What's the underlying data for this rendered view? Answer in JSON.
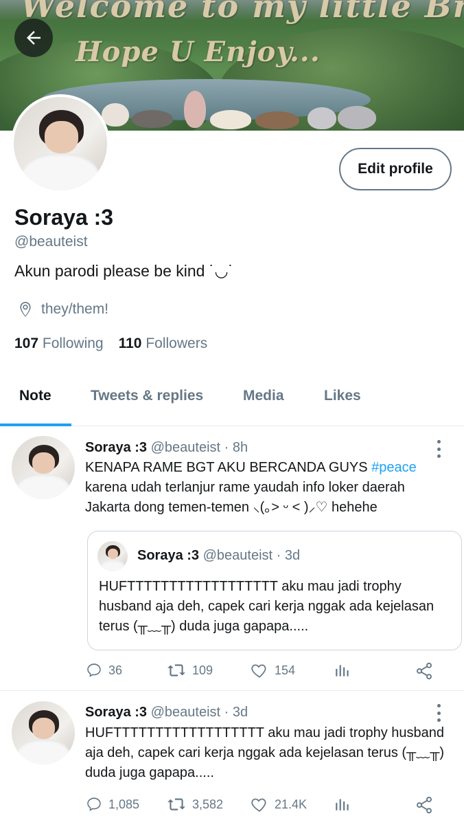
{
  "banner": {
    "line1": "Welcome to my little Brain...",
    "line2": "Hope U Enjoy..."
  },
  "nav": {
    "back_icon": "arrow-left-icon"
  },
  "profile": {
    "display_name": "Soraya :3",
    "handle": "@beauteist",
    "bio": "Akun parodi please be kind ˙◡˙",
    "location": "they/them!",
    "following_count": "107",
    "following_label": "Following",
    "followers_count": "110",
    "followers_label": "Followers",
    "edit_button": "Edit profile"
  },
  "tabs": [
    {
      "label": "Note",
      "active": true
    },
    {
      "label": "Tweets & replies",
      "active": false
    },
    {
      "label": "Media",
      "active": false
    },
    {
      "label": "Likes",
      "active": false
    }
  ],
  "tweets": [
    {
      "name": "Soraya :3",
      "handle": "@beauteist",
      "time": "· 8h",
      "text_main": "KENAPA RAME BGT AKU BERCANDA GUYS ",
      "hashtag": "#peace",
      "text_rest": "karena udah terlanjur rame yaudah info loker daerah Jakarta dong temen-temen ⸜(｡˃ ᵕ ˂ )⸝♡ hehehe",
      "quote": {
        "name": "Soraya :3",
        "handle": "@beauteist",
        "time": "· 3d",
        "text": "HUFTTTTTTTTTTTTTTTTTT aku mau jadi trophy husband aja deh, capek cari kerja nggak ada kejelasan terus (╥﹏╥) duda juga gapapa....."
      },
      "replies": "36",
      "retweets": "109",
      "likes": "154"
    },
    {
      "name": "Soraya :3",
      "handle": "@beauteist",
      "time": "· 3d",
      "text": "HUFTTTTTTTTTTTTTTTTTT aku mau jadi trophy husband aja deh, capek cari kerja nggak ada kejelasan terus (╥﹏╥) duda juga gapapa.....",
      "replies": "1,085",
      "retweets": "3,582",
      "likes": "21.4K"
    }
  ],
  "colors": {
    "accent": "#1da1f2",
    "text": "#14171a",
    "muted": "#657786",
    "border": "#e6ecf0"
  }
}
